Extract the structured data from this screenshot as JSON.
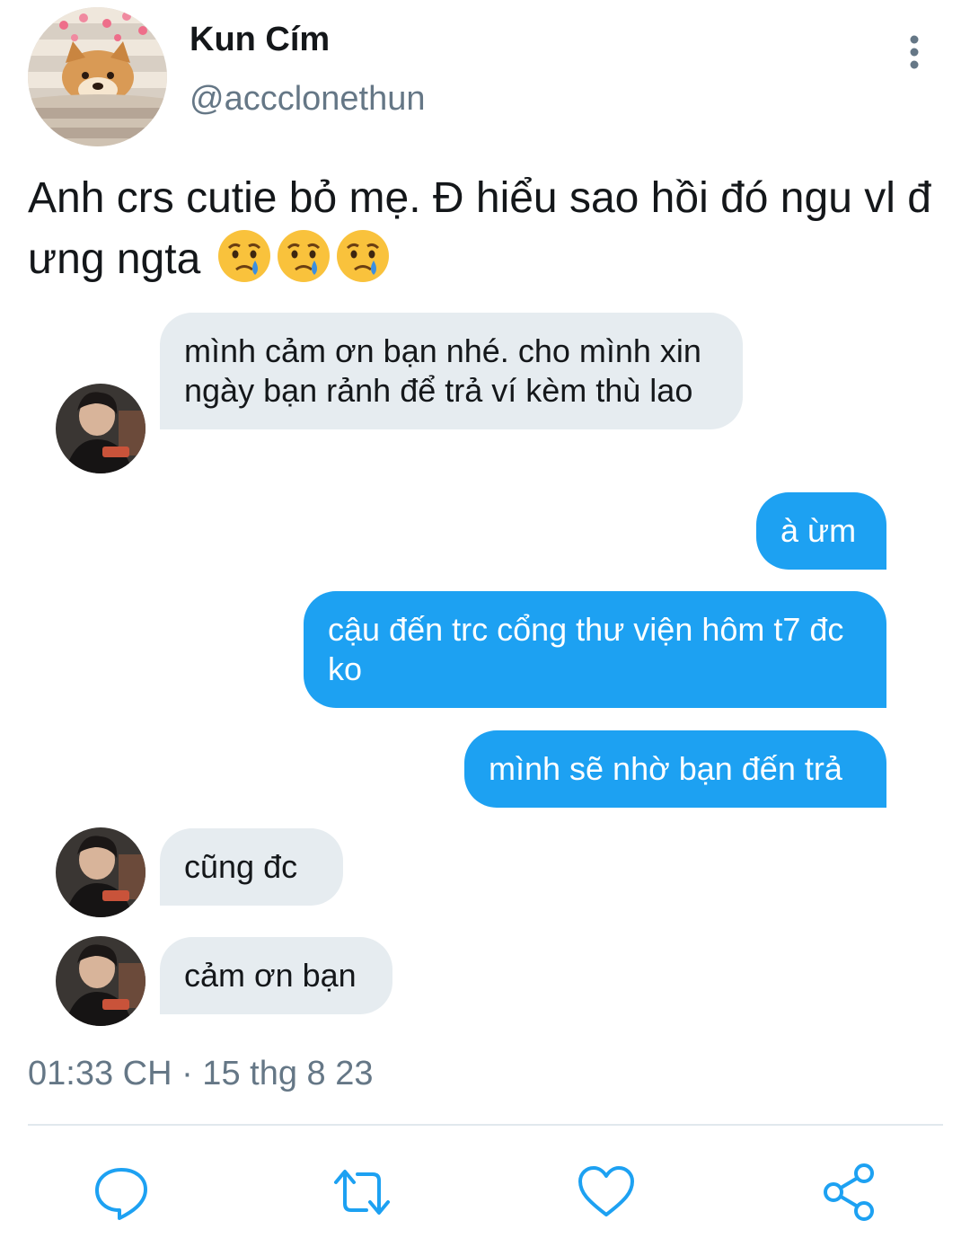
{
  "tweet": {
    "display_name": "Kun Cím",
    "handle": "@accclonethun",
    "text": "Anh crs cutie bỏ mẹ. Đ hiểu sao hồi đó ngu vl đ ưng ngta",
    "emojis": [
      "crying-face",
      "crying-face",
      "crying-face"
    ],
    "timestamp": "01:33 CH · 15 thg 8 23"
  },
  "chat": {
    "messages": [
      {
        "side": "incoming",
        "text": "mình cảm ơn bạn nhé. cho mình xin ngày bạn rảnh để trả ví kèm thù lao"
      },
      {
        "side": "outgoing",
        "text": "à ừm"
      },
      {
        "side": "outgoing",
        "text": "cậu đến trc cổng thư viện hôm t7 đc ko"
      },
      {
        "side": "outgoing",
        "text": "mình sẽ nhờ bạn đến trả"
      },
      {
        "side": "incoming",
        "text": "cũng đc"
      },
      {
        "side": "incoming",
        "text": "cảm ơn bạn"
      }
    ]
  },
  "actions": [
    "reply-icon",
    "retweet-icon",
    "like-icon",
    "share-icon"
  ],
  "colors": {
    "accent": "#1da1f2",
    "incoming_bubble": "#e6ecf0",
    "secondary_text": "#657786",
    "icon": "#1da1f2"
  }
}
